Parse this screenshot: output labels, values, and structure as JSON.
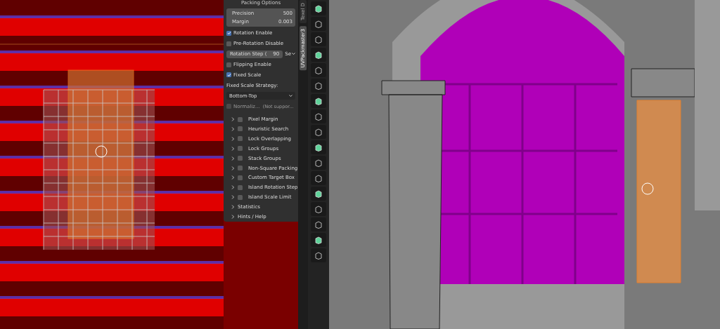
{
  "side_tabs": [
    {
      "label": "Texel D",
      "selected": false
    },
    {
      "label": "UVPackmaster3",
      "selected": true
    }
  ],
  "panel": {
    "header": "Packing Options",
    "fields": [
      {
        "label": "Precision",
        "value": "500"
      },
      {
        "label": "Margin",
        "value": "0.003"
      }
    ],
    "options": [
      {
        "kind": "check",
        "label": "Rotation Enable",
        "checked": true
      },
      {
        "kind": "check",
        "label": "Pre-Rotation Disable",
        "checked": false
      },
      {
        "kind": "number",
        "label": "Rotation Step (",
        "value": "90",
        "dropdown": "Se"
      },
      {
        "kind": "check",
        "label": "Flipping Enable",
        "checked": false
      },
      {
        "kind": "check",
        "label": "Fixed Scale",
        "checked": true
      },
      {
        "kind": "label",
        "label": "Fixed Scale Strategy:"
      },
      {
        "kind": "select",
        "value": "Bottom-Top"
      },
      {
        "kind": "check",
        "label": "Normaliz...",
        "note": "(Not suppor...",
        "checked": false,
        "disabled": true
      }
    ],
    "subpanels": [
      {
        "label": "Pixel Margin",
        "checked": false
      },
      {
        "label": "Heuristic Search",
        "checked": false
      },
      {
        "label": "Lock Overlapping",
        "checked": false
      },
      {
        "label": "Lock Groups",
        "checked": false
      },
      {
        "label": "Stack Groups",
        "checked": false
      },
      {
        "label": "Non-Square Packing",
        "checked": false
      },
      {
        "label": "Custom Target Box",
        "checked": false
      },
      {
        "label": "Island Rotation Step",
        "checked": false
      },
      {
        "label": "Island Scale Limit",
        "checked": false
      }
    ],
    "sections": [
      {
        "label": "Statistics",
        "expanded": false
      },
      {
        "label": "Hints / Help",
        "expanded": false
      }
    ]
  }
}
